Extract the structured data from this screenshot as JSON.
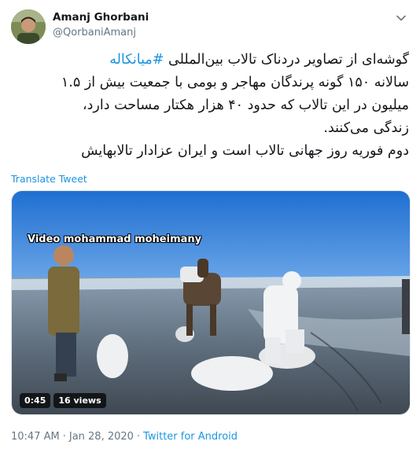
{
  "author": {
    "name": "Amanj Ghorbani",
    "handle": "@QorbaniAmanj"
  },
  "tweet": {
    "lines": [
      {
        "hashtag": "#میانکاله",
        "text": "گوشه‌ای از تصاویر دردناک تالاب بین‌المللی "
      },
      {
        "text": "سالانه ۱۵۰ گونه پرندگان مهاجر و بومی با جمعیت بیش از ۱.۵"
      },
      {
        "text": "میلیون در این تالاب که حدود ۴۰ هزار هکتار مساحت دارد،"
      },
      {
        "text": "زندگی می‌کنند."
      },
      {
        "text": "دوم فوریه روز جهانی تالاب است و ایران عزادار تالابهایش"
      }
    ]
  },
  "translate_label": "Translate Tweet",
  "media": {
    "type": "video",
    "watermark": "Video mohammad moheimany",
    "duration": "0:45",
    "views": "16 views"
  },
  "meta": {
    "time": "10:47 AM",
    "separator": "·",
    "date": "Jan 28, 2020",
    "source": "Twitter for Android"
  },
  "icons": {
    "more": "chevron-down-icon",
    "avatar": "user-avatar"
  },
  "colors": {
    "link": "#1b95e0",
    "secondary": "#657786",
    "text": "#14171a"
  }
}
